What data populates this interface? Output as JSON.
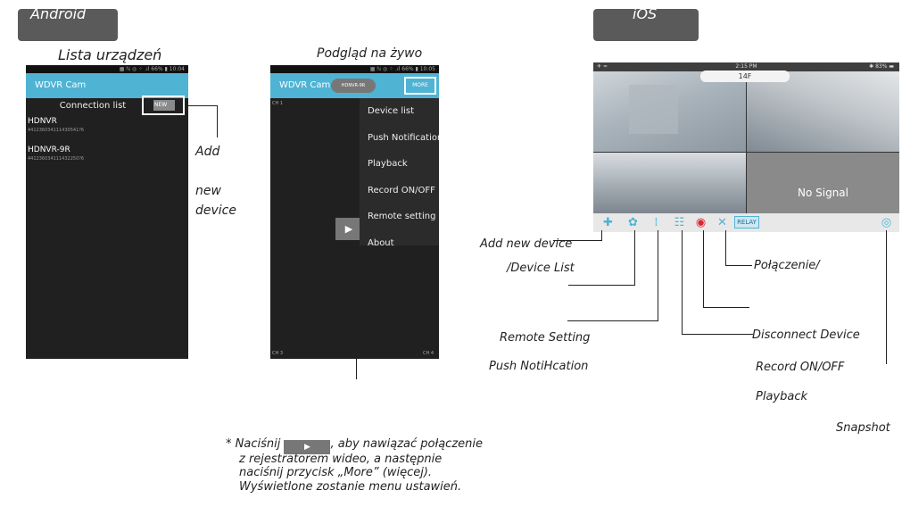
{
  "platforms": {
    "android": "Android",
    "ios": "iOS"
  },
  "android_list": {
    "heading": "Lista urządzeń",
    "status": "▦ ℕ ◎ ⁘ .ıl 66% ▮ 10:04",
    "app_title": "WDVR Cam",
    "list_title": "Connection list",
    "new_button": "NEW",
    "devices": [
      {
        "name": "HDNVR",
        "id": "441236034111430541?6"
      },
      {
        "name": "HDNVR-9R",
        "id": "441236034111432250?6"
      }
    ],
    "caption_add": "Add",
    "caption_new": "new",
    "caption_device": "device"
  },
  "android_live": {
    "heading": "Podgląd na żywo",
    "status": "▦ ℕ ◎ ⁘ .ıl 66% ▮ 10:05",
    "app_title": "WDVR Cam",
    "device_chip": "HDNVR-9R",
    "more_button": "MORE",
    "ch1": "CH 1",
    "ch3": "CH 3",
    "ch4": "CH 4",
    "menu": [
      "Device list",
      "Push Notification Setting",
      "Playback",
      "Record ON/OFF",
      "Remote setting",
      "About"
    ]
  },
  "note": {
    "line1_a": "* Naciśnij",
    "line1_b": ", aby nawiązać połączenie",
    "line2": "z rejestratorem wideo, a następnie",
    "line3": "naciśnij przycisk „More” (więcej).",
    "line4": "Wyświetlone zostanie menu ustawień."
  },
  "ios": {
    "status_left": "✈ ≈",
    "time": "2:15 PM",
    "status_right": "✱ 83% ▬",
    "cam_label": "14F",
    "no_signal": "No Signal",
    "relay": "RELAY",
    "labels": {
      "add_new_device": "Add new device",
      "device_list": "/Device List",
      "polaczenie": "Połączenie/",
      "remote_setting": "Remote Setting",
      "disconnect_device": "Disconnect Device",
      "push_notification": "Push NotiHcation",
      "record_onoff": "Record ON/OFF",
      "playback": "Playback",
      "snapshot": "Snapshot"
    }
  },
  "colors": {
    "accent": "#4fb3d4",
    "tab_bg": "#5a5a5a",
    "record": "#e0242e"
  }
}
